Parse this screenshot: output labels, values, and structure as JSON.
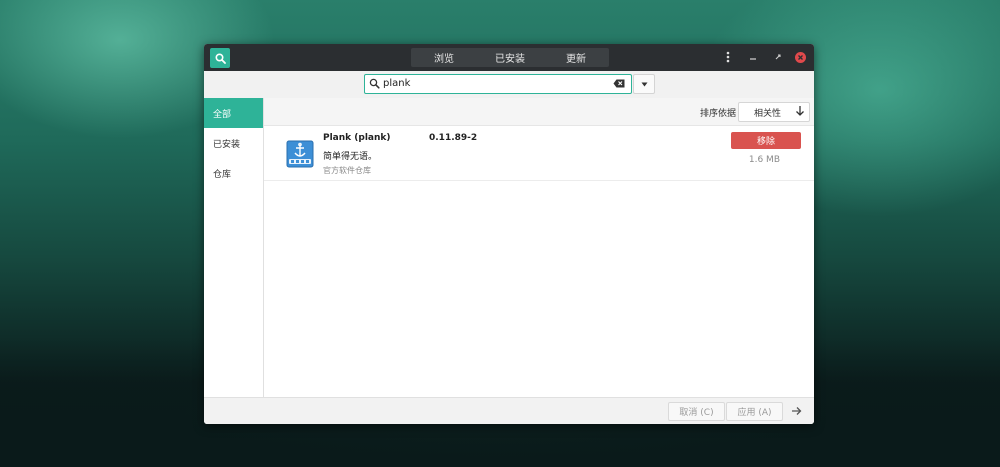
{
  "titlebar": {
    "tabs": [
      {
        "label": "浏览"
      },
      {
        "label": "已安装"
      },
      {
        "label": "更新"
      }
    ]
  },
  "search": {
    "value": "plank"
  },
  "sidebar": {
    "items": [
      {
        "label": "全部"
      },
      {
        "label": "已安装"
      },
      {
        "label": "仓库"
      }
    ]
  },
  "sort": {
    "label": "排序依据",
    "selected": "相关性"
  },
  "package": {
    "name": "Plank (plank)",
    "version": "0.11.89-2",
    "description": "简单得无语。",
    "repository": "官方软件仓库",
    "remove_label": "移除",
    "size": "1.6 MB"
  },
  "footer": {
    "cancel_label": "取消 (C)",
    "apply_label": "应用 (A)"
  },
  "colors": {
    "accent": "#2eb398",
    "remove": "#d9534f",
    "titlebar": "#2b2e31"
  },
  "icons": {
    "search_toggle": "search-icon",
    "menu": "kebab-menu-icon",
    "minimize": "minimize-icon",
    "maximize": "maximize-icon",
    "close": "close-icon",
    "clear": "backspace-clear-icon",
    "dropdown": "chevron-down-icon",
    "sort_direction": "arrow-down-icon",
    "package": "plank-dock-icon",
    "next": "arrow-right-icon"
  }
}
